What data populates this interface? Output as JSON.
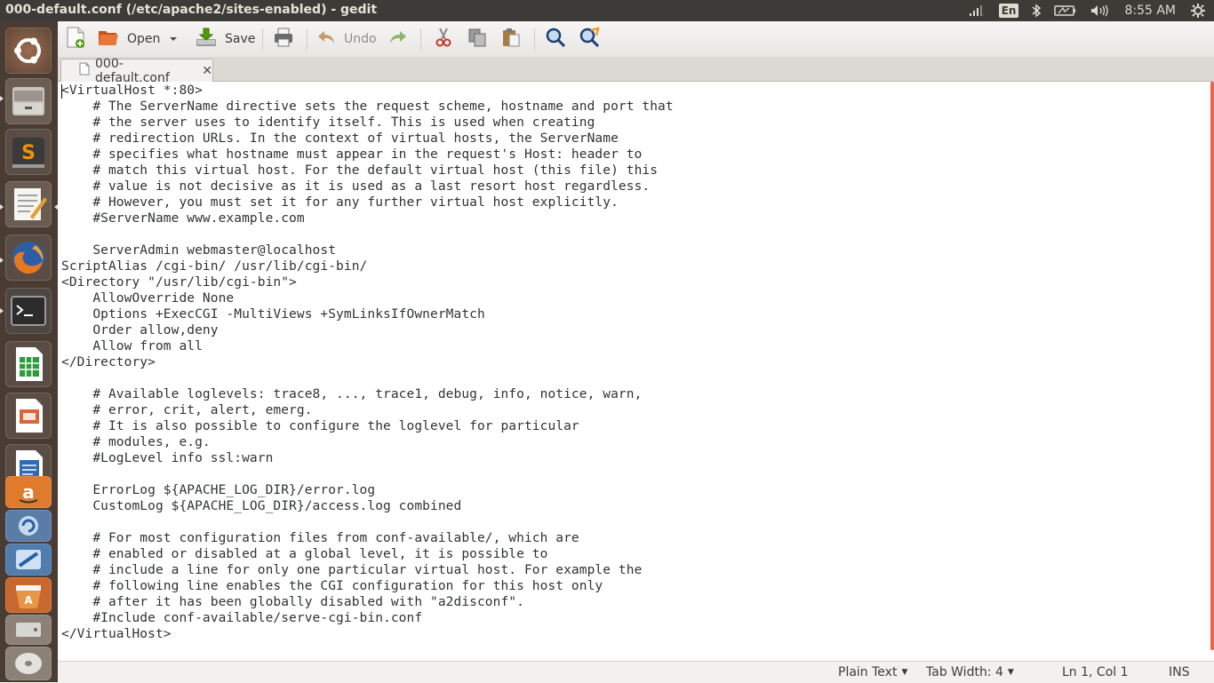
{
  "window": {
    "title": "000-default.conf (/etc/apache2/sites-enabled) - gedit"
  },
  "panel": {
    "language": "En",
    "clock": "8:55 AM",
    "icons": [
      "network-signal-icon",
      "keyboard-language-icon",
      "bluetooth-icon",
      "battery-icon",
      "volume-icon",
      "gear-icon"
    ]
  },
  "launcher": {
    "items": [
      "ubuntu-dash-icon",
      "files-icon",
      "sublime-text-icon",
      "text-editor-icon",
      "firefox-icon",
      "terminal-icon",
      "libreoffice-calc-icon",
      "libreoffice-impress-icon",
      "libreoffice-writer-icon",
      "amazon-icon",
      "software-updater-icon",
      "system-settings-icon",
      "software-center-icon",
      "disks-icon",
      "optical-drive-icon"
    ]
  },
  "toolbar": {
    "new_icon": "new-document-icon",
    "open_label": "Open",
    "save_label": "Save",
    "print_icon": "print-icon",
    "undo_label": "Undo",
    "redo_icon": "redo-icon",
    "cut_icon": "cut-icon",
    "copy_icon": "copy-icon",
    "paste_icon": "paste-icon",
    "find_icon": "find-icon",
    "replace_icon": "find-replace-icon"
  },
  "tab": {
    "label": "000-default.conf"
  },
  "editor": {
    "text": "<VirtualHost *:80>\n    # The ServerName directive sets the request scheme, hostname and port that\n    # the server uses to identify itself. This is used when creating\n    # redirection URLs. In the context of virtual hosts, the ServerName\n    # specifies what hostname must appear in the request's Host: header to\n    # match this virtual host. For the default virtual host (this file) this\n    # value is not decisive as it is used as a last resort host regardless.\n    # However, you must set it for any further virtual host explicitly.\n    #ServerName www.example.com\n\n    ServerAdmin webmaster@localhost\nScriptAlias /cgi-bin/ /usr/lib/cgi-bin/\n<Directory \"/usr/lib/cgi-bin\">\n    AllowOverride None\n    Options +ExecCGI -MultiViews +SymLinksIfOwnerMatch\n    Order allow,deny\n    Allow from all\n</Directory>\n\n    # Available loglevels: trace8, ..., trace1, debug, info, notice, warn,\n    # error, crit, alert, emerg.\n    # It is also possible to configure the loglevel for particular\n    # modules, e.g.\n    #LogLevel info ssl:warn\n\n    ErrorLog ${APACHE_LOG_DIR}/error.log\n    CustomLog ${APACHE_LOG_DIR}/access.log combined\n\n    # For most configuration files from conf-available/, which are\n    # enabled or disabled at a global level, it is possible to\n    # include a line for only one particular virtual host. For example the\n    # following line enables the CGI configuration for this host only\n    # after it has been globally disabled with \"a2disconf\".\n    #Include conf-available/serve-cgi-bin.conf\n</VirtualHost>"
  },
  "statusbar": {
    "language": "Plain Text",
    "tab_width": "Tab Width: 4",
    "position": "Ln 1, Col 1",
    "mode": "INS"
  },
  "colors": {
    "panel": "#3c3b37",
    "launcher": "#4b3c33",
    "scrollbar": "#e8644b",
    "toolbar": "#efedea"
  }
}
